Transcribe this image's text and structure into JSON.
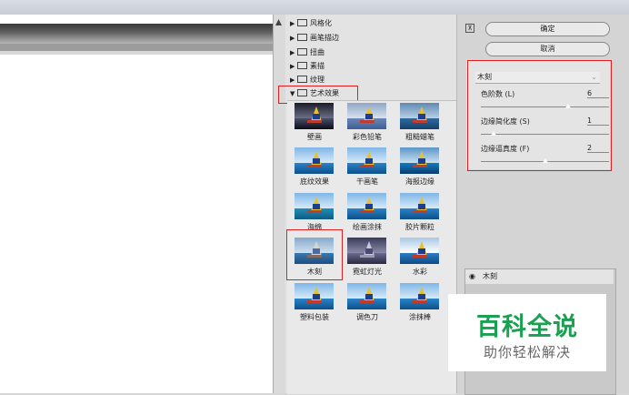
{
  "tree": {
    "items": [
      {
        "label": "风格化",
        "expanded": false
      },
      {
        "label": "画笔描边",
        "expanded": false
      },
      {
        "label": "扭曲",
        "expanded": false
      },
      {
        "label": "素描",
        "expanded": false
      },
      {
        "label": "纹理",
        "expanded": false
      },
      {
        "label": "艺术效果",
        "expanded": true
      }
    ],
    "collapsed_glyph": "▶",
    "expanded_glyph": "▼"
  },
  "gallery": [
    {
      "label": "壁画"
    },
    {
      "label": "彩色铅笔"
    },
    {
      "label": "粗糙蜡笔"
    },
    {
      "label": "底纹效果"
    },
    {
      "label": "干画笔"
    },
    {
      "label": "海报边缘"
    },
    {
      "label": "海绵"
    },
    {
      "label": "绘画涂抹"
    },
    {
      "label": "胶片颗粒"
    },
    {
      "label": "木刻"
    },
    {
      "label": "霓虹灯光"
    },
    {
      "label": "水彩"
    },
    {
      "label": "塑料包装"
    },
    {
      "label": "调色刀"
    },
    {
      "label": "涂抹棒"
    }
  ],
  "buttons": {
    "ok": "确定",
    "cancel": "取消"
  },
  "zoom_glyph": "⊼",
  "settings": {
    "filter_name": "木刻",
    "params": [
      {
        "label": "色阶数 (L)",
        "value": "6",
        "fraction": 0.68
      },
      {
        "label": "边缘简化度 (S)",
        "value": "1",
        "fraction": 0.1
      },
      {
        "label": "边缘逼真度 (F)",
        "value": "2",
        "fraction": 0.5
      }
    ]
  },
  "layer": {
    "name": "木刻",
    "eye": "◉"
  },
  "watermark": {
    "title": "百科全说",
    "subtitle": "助你轻松解决"
  },
  "colors": {
    "accent_red": "#e02020",
    "watermark_green": "#1aa051"
  }
}
